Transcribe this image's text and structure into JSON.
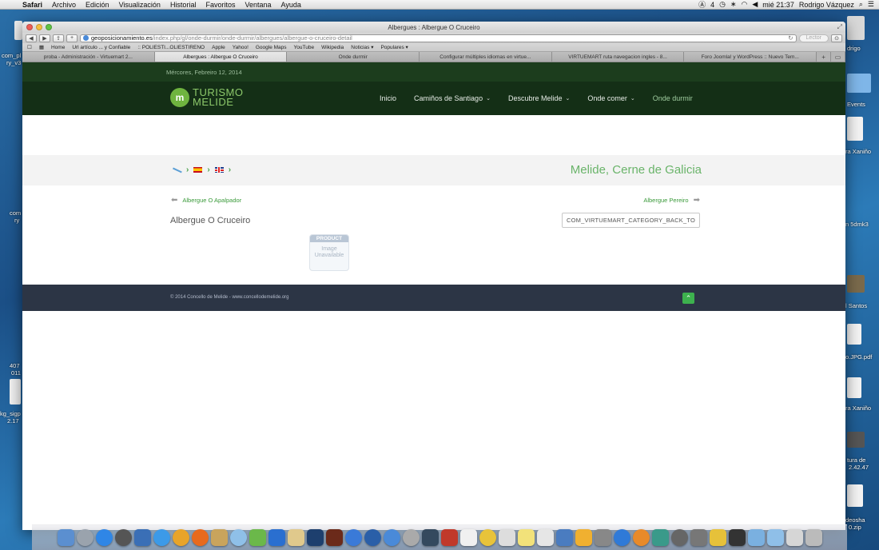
{
  "menubar": {
    "app_name": "Safari",
    "menus": [
      "Archivo",
      "Edición",
      "Visualización",
      "Historial",
      "Favoritos",
      "Ventana",
      "Ayuda"
    ],
    "status_items": [
      "4",
      "mié 21:37",
      "Rodrigo Vázquez"
    ]
  },
  "desktop": {
    "left_labels": [
      "com_pl",
      "ry_v3",
      "com",
      "ry",
      "407",
      "011",
      "kg_sigp",
      "2.17"
    ],
    "right_labels": [
      "drigo",
      "Events",
      "ra Xaniño",
      "n 5dmk3",
      "l Santos",
      "o.JPG.pdf",
      "ra Xaniño",
      "tura de",
      "2.42.47",
      "deosha",
      "0.zip"
    ]
  },
  "browser": {
    "window_title": "Albergues : Albergue O Cruceiro",
    "url_host": "geoposicionamiento.es",
    "url_path": "/index.php/gl/onde-durmir/onde-durmir/albergues/albergue-o-cruceiro-detail",
    "reader_label": "Lector",
    "bookmarks": [
      "Home",
      "Url artículo ... y Confiable",
      ":: POLIESTI...OLIESTIRENO",
      "Apple",
      "Yahoo!",
      "Google Maps",
      "YouTube",
      "Wikipedia",
      "Noticias ▾",
      "Populares ▾"
    ],
    "tabs": [
      {
        "label": "proba - Administración - Virtuemart 2..."
      },
      {
        "label": "Albergues : Albergue O Cruceiro"
      },
      {
        "label": "Onde durmir"
      },
      {
        "label": "Configurar múltiples idiomas en virtue..."
      },
      {
        "label": "VIRTUEMART ruta navegacion ingles - 8..."
      },
      {
        "label": "Foro Joomla! y WordPress :: Nuevo Tem..."
      }
    ],
    "active_tab_index": 1
  },
  "site": {
    "date": "Mércores, Febreiro 12, 2014",
    "logo_mark": "m",
    "logo_line1": "TURISMO",
    "logo_line2": "MELIDE",
    "nav": [
      {
        "label": "Inicio",
        "has_dropdown": false
      },
      {
        "label": "Camiños de Santiago",
        "has_dropdown": true
      },
      {
        "label": "Descubre Melide",
        "has_dropdown": true
      },
      {
        "label": "Onde comer",
        "has_dropdown": true
      },
      {
        "label": "Onde durmir",
        "has_dropdown": false
      }
    ],
    "slogan": "Melide, Cerne de Galicia",
    "prev_product": "Albergue O Apalpador",
    "next_product": "Albergue Pereiro",
    "product_title": "Albergue O Cruceiro",
    "back_button": "COM_VIRTUEMART_CATEGORY_BACK_TO",
    "image_placeholder": {
      "header": "PRODUCT",
      "line1": "Image",
      "line2": "Unavailable"
    },
    "copyright": "© 2014 Concello de Melide - www.concellodemelide.org"
  },
  "colors": {
    "header_green": "#142f16",
    "date_bar": "#1c3d1d",
    "accent_green": "#6ab46a",
    "footer": "#2c3545",
    "top_button": "#3db14e"
  }
}
